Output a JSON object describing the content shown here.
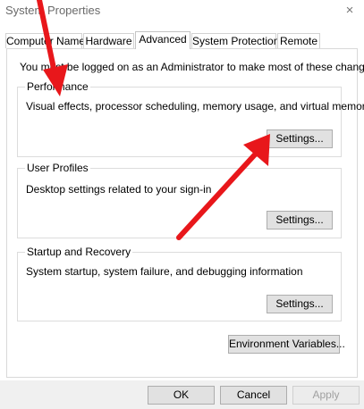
{
  "window": {
    "title": "System Properties",
    "close_icon": "×"
  },
  "tabs": [
    {
      "label": "Computer Name",
      "active": false
    },
    {
      "label": "Hardware",
      "active": false
    },
    {
      "label": "Advanced",
      "active": true
    },
    {
      "label": "System Protection",
      "active": false
    },
    {
      "label": "Remote",
      "active": false
    }
  ],
  "notice": "You must be logged on as an Administrator to make most of these changes.",
  "performance": {
    "title": "Performance",
    "description": "Visual effects, processor scheduling, memory usage, and virtual memory",
    "button": "Settings..."
  },
  "user_profiles": {
    "title": "User Profiles",
    "description": "Desktop settings related to your sign-in",
    "button": "Settings..."
  },
  "startup_recovery": {
    "title": "Startup and Recovery",
    "description": "System startup, system failure, and debugging information",
    "button": "Settings..."
  },
  "environment_button": "Environment Variables...",
  "footer": {
    "ok": "OK",
    "cancel": "Cancel",
    "apply": "Apply"
  },
  "annotation_color": "#e8171b"
}
